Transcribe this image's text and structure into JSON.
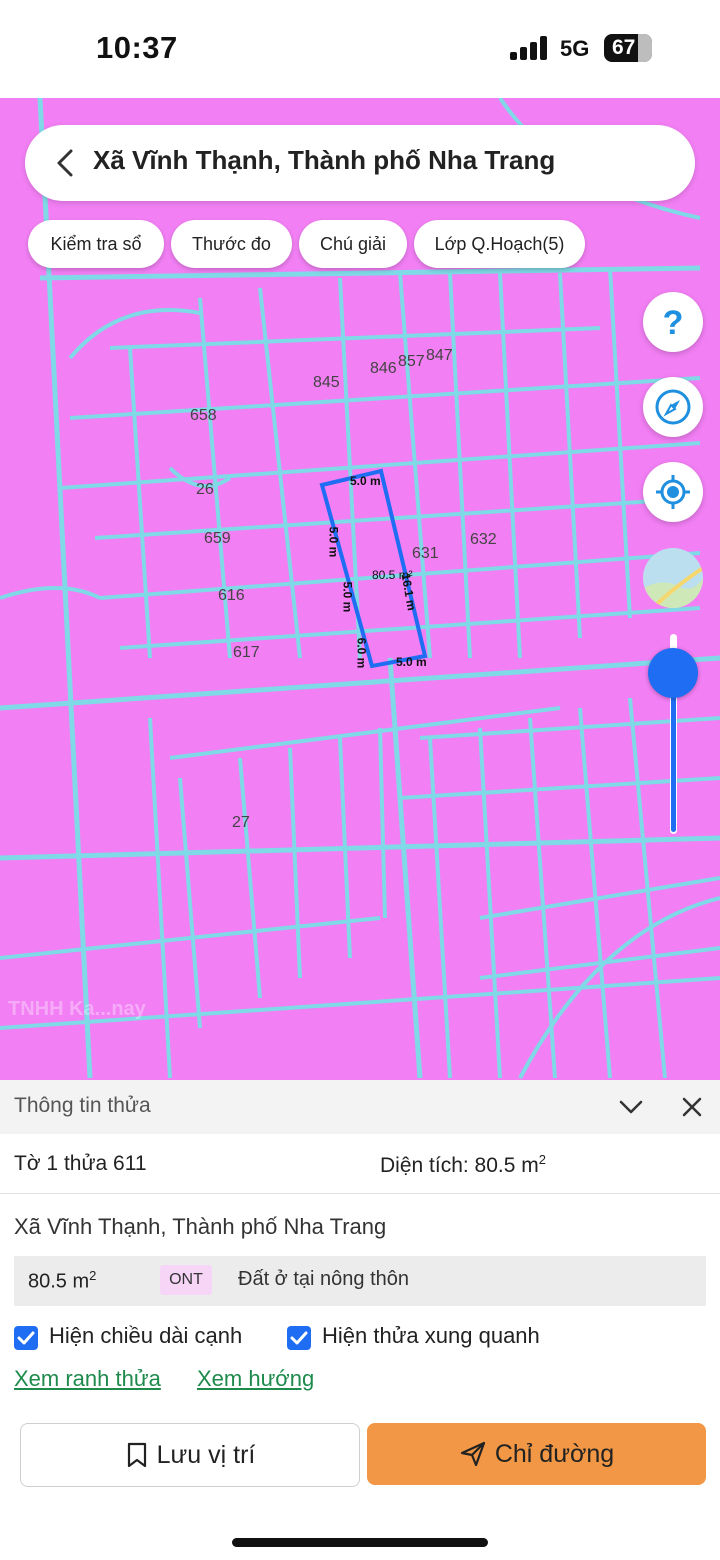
{
  "status_bar": {
    "time": "10:37",
    "network": "5G",
    "battery": "67"
  },
  "search": {
    "text": "Xã Vĩnh Thạnh, Thành phố Nha Trang"
  },
  "chips": [
    {
      "label": "Kiểm tra sổ"
    },
    {
      "label": "Thước đo"
    },
    {
      "label": "Chú giải"
    },
    {
      "label": "Lớp Q.Hoạch(5)"
    }
  ],
  "map": {
    "parcel_labels": [
      "845",
      "846",
      "857",
      "847",
      "658",
      "26",
      "659",
      "616",
      "617",
      "631",
      "632",
      "27"
    ],
    "selected_parcel": {
      "area_label": "80.5 m²",
      "edges": [
        "5.0 m",
        "5.0 m",
        "5.0 m",
        "5.0 m",
        "6.0 m",
        "16.1 m"
      ]
    },
    "watermark": "TNHH Ka...nay",
    "zoom_level_fraction": 0.9
  },
  "panel": {
    "title": "Thông tin thửa",
    "sheet_parcel": "Tờ 1 thửa 611",
    "area_label": "Diện tích: 80.5 m",
    "area_sup": "2",
    "address": "Xã Vĩnh Thạnh, Thành phố Nha Trang",
    "land_row": {
      "area": "80.5 m",
      "area_sup": "2",
      "code": "ONT",
      "description": "Đất ở tại nông thôn"
    },
    "checkboxes": [
      {
        "label": "Hiện chiều dài cạnh",
        "checked": true
      },
      {
        "label": "Hiện thửa xung quanh",
        "checked": true
      }
    ],
    "links": [
      {
        "label": "Xem ranh thửa"
      },
      {
        "label": "Xem hướng"
      }
    ],
    "save_button": "Lưu vị trí",
    "directions_button": "Chỉ đường"
  },
  "colors": {
    "map_bg": "#f27ff4",
    "parcel_lines": "#7fd9e6",
    "accent": "#1f6df2",
    "directions": "#f19745"
  }
}
